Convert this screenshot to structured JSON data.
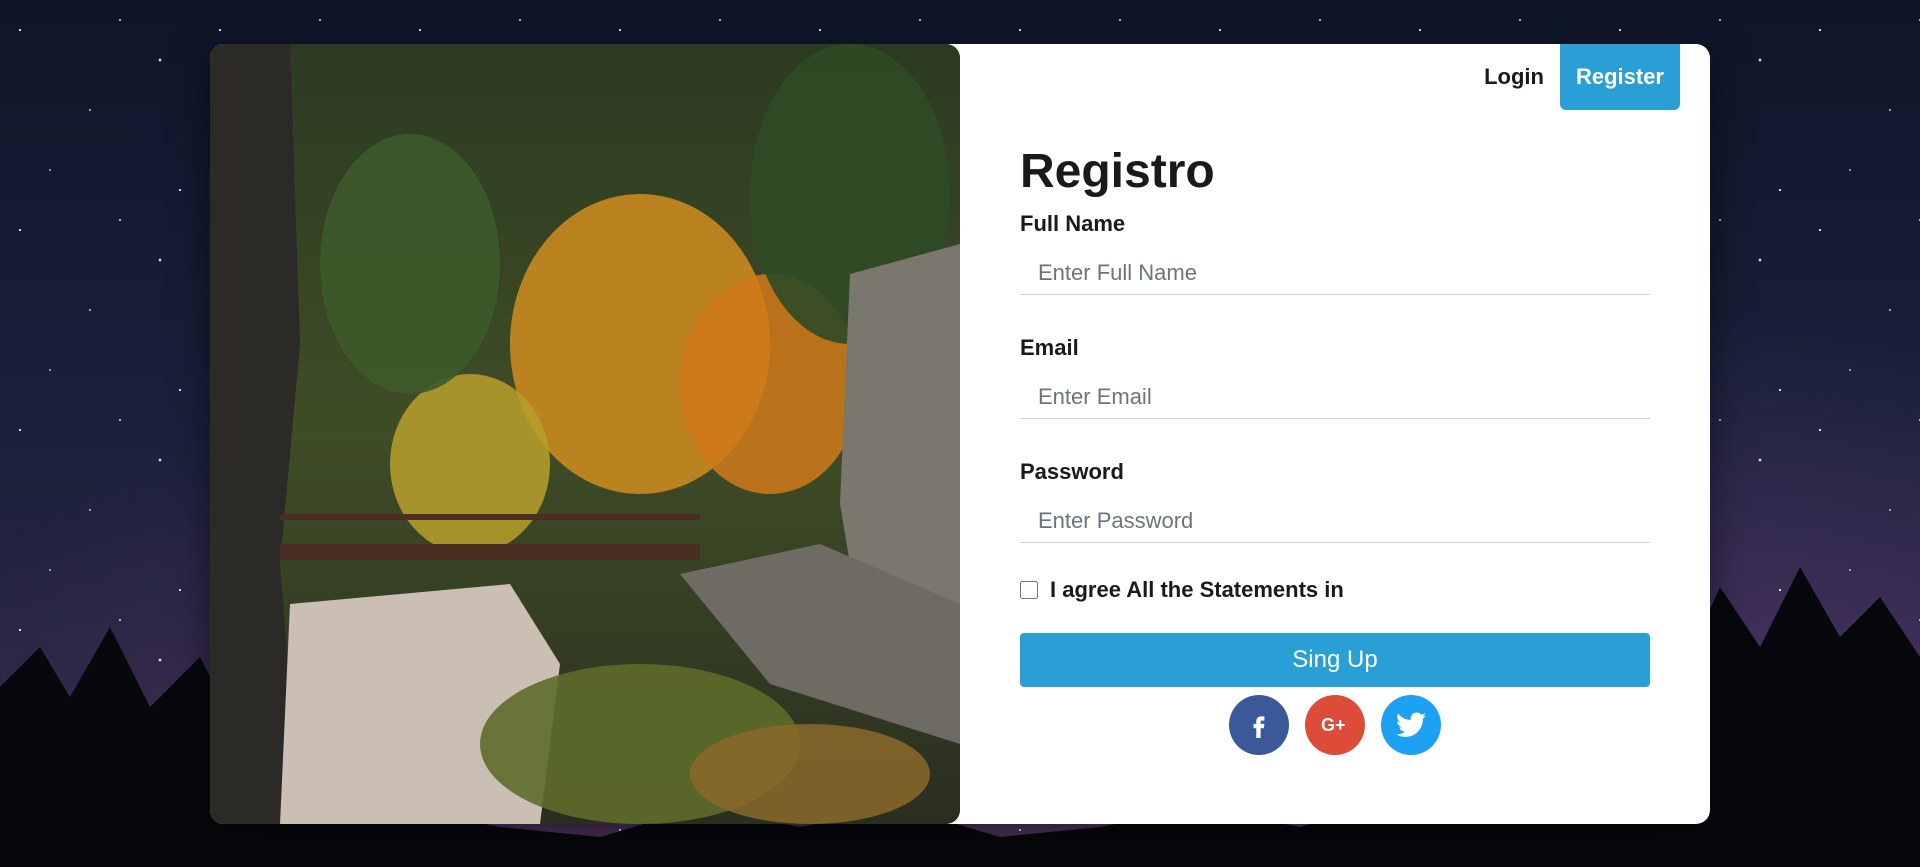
{
  "nav": {
    "login_label": "Login",
    "register_label": "Register"
  },
  "form": {
    "title": "Registro",
    "full_name": {
      "label": "Full Name",
      "placeholder": "Enter Full Name"
    },
    "email": {
      "label": "Email",
      "placeholder": "Enter Email"
    },
    "password": {
      "label": "Password",
      "placeholder": "Enter Password"
    },
    "agree_text": "I agree All the Statements in",
    "submit_label": "Sing Up"
  },
  "social": [
    {
      "name": "facebook-icon",
      "color": "#3b5998"
    },
    {
      "name": "google-plus-icon",
      "color": "#dd4b39"
    },
    {
      "name": "twitter-icon",
      "color": "#1da1f2"
    }
  ],
  "colors": {
    "accent": "#2a9fd6",
    "text": "#1a1a1a"
  }
}
